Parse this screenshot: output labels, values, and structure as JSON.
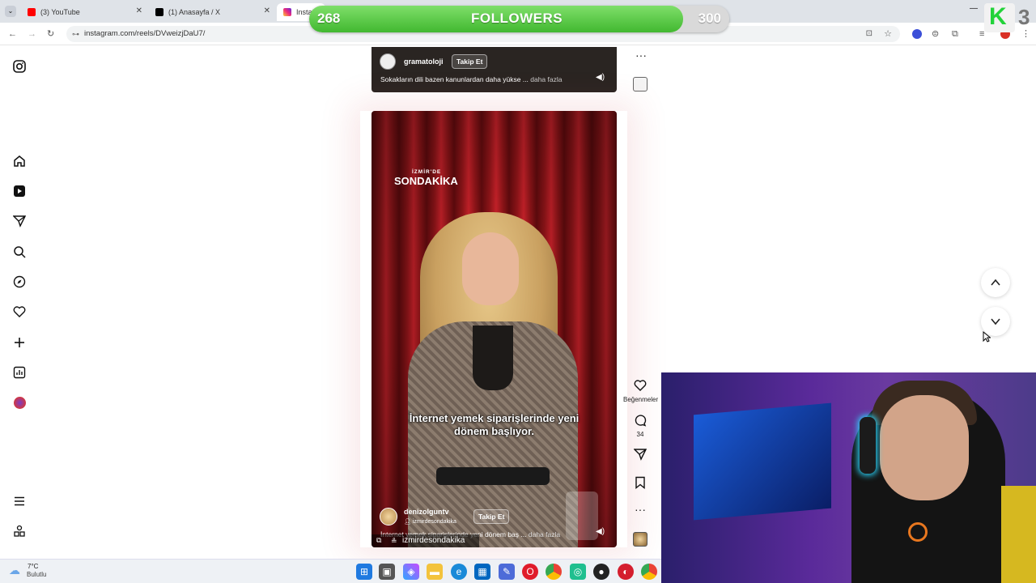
{
  "browser": {
    "tabs": [
      {
        "title": "(3) YouTube",
        "icon": "youtube-icon"
      },
      {
        "title": "(1) Anasayfa / X",
        "icon": "x-icon"
      },
      {
        "title": "Instag",
        "icon": "instagram-icon"
      }
    ],
    "url": "instagram.com/reels/DVweizjDaU7/"
  },
  "followers_overlay": {
    "current": "268",
    "label": "FOLLOWERS",
    "goal": "300",
    "progress": 0.89,
    "badge_letter": "K",
    "badge_number": "3"
  },
  "sidebar": {
    "items": [
      "instagram-logo",
      "home-icon",
      "reels-icon",
      "messages-icon",
      "search-icon",
      "explore-icon",
      "notifications-icon",
      "create-icon",
      "dashboard-icon",
      "profile-avatar",
      "more-menu-icon",
      "also-from-meta-icon"
    ]
  },
  "reel_top": {
    "username": "gramatoloji",
    "follow_label": "Takip Et",
    "caption": "Sokakların dili bazen kanunlardan daha yükse ...",
    "more_label": "daha fazla"
  },
  "reel_main": {
    "logo_line1": "İZMİR'DE",
    "logo_line2": "SONDAKİKA",
    "subtitle_line1": "İnternet yemek siparişlerinde yeni",
    "subtitle_line2": "dönem başlıyor.",
    "username": "denizolguntv",
    "collab": "izmirdesondakika",
    "follow_label": "Takip Et",
    "caption": "İnternet yemek siparişlerinde yeni dönem baş ...",
    "more_label": "daha fazla",
    "tagged": "izmirdesondakika"
  },
  "actions": {
    "likes_label": "Beğenmeler",
    "comments_count": "34"
  },
  "taskbar": {
    "weather_temp": "7°C",
    "weather_desc": "Bulutlu"
  },
  "colors": {
    "followers_green": "#41b830",
    "reel_red": "#c02028",
    "instagram_gradient": "#d62976"
  }
}
